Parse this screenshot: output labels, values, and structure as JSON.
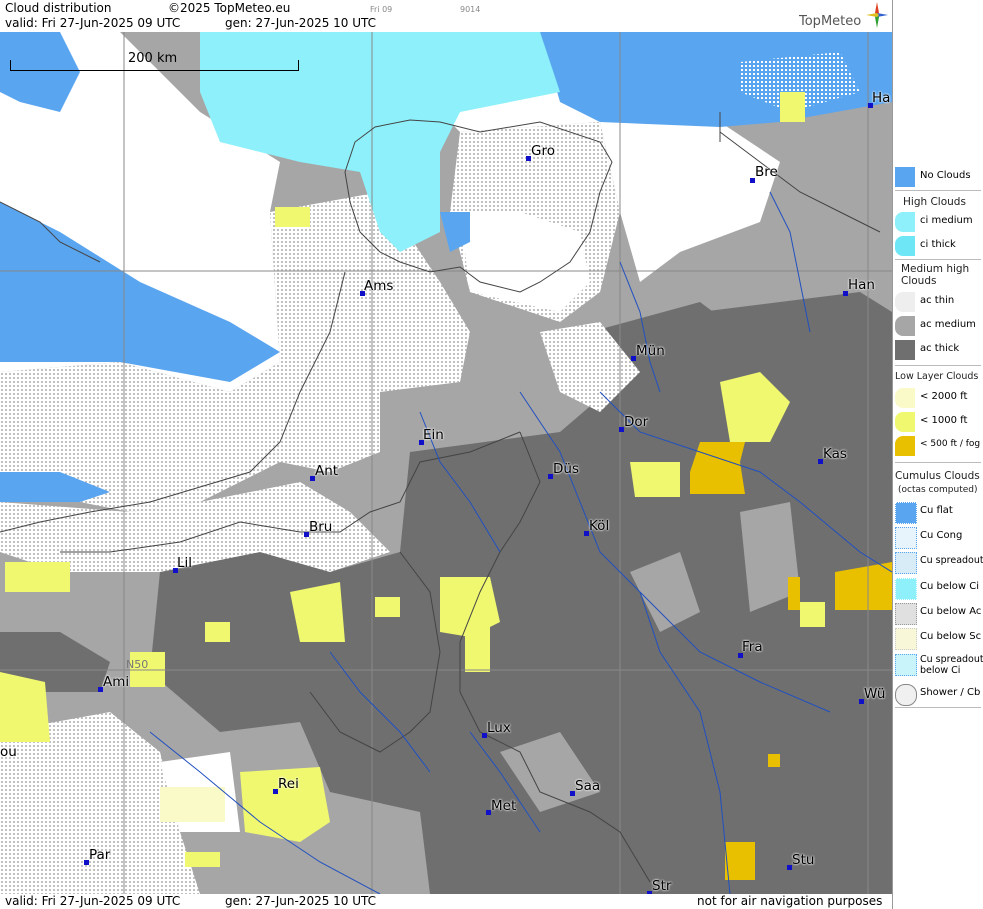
{
  "header": {
    "title": "Cloud distribution",
    "copyright": "©2025 TopMeteo.eu",
    "valid": "valid:  Fri  27-Jun-2025  09 UTC",
    "gen": "gen: 27-Jun-2025 10 UTC",
    "slot": "Fri 09",
    "code": "9014",
    "logo": "TopMeteo"
  },
  "scale": {
    "label": "200 km"
  },
  "grid_label": "N50",
  "cities": [
    {
      "name": "Gro"
    },
    {
      "name": "Bre"
    },
    {
      "name": "Ha"
    },
    {
      "name": "Ams"
    },
    {
      "name": "Han"
    },
    {
      "name": "Mün"
    },
    {
      "name": "Ein"
    },
    {
      "name": "Dor"
    },
    {
      "name": "Kas"
    },
    {
      "name": "Ant"
    },
    {
      "name": "Düs"
    },
    {
      "name": "Bru"
    },
    {
      "name": "Köl"
    },
    {
      "name": "Lil"
    },
    {
      "name": "Fra"
    },
    {
      "name": "Ami"
    },
    {
      "name": "Wü"
    },
    {
      "name": "ou"
    },
    {
      "name": "Lux"
    },
    {
      "name": "Rei"
    },
    {
      "name": "Saa"
    },
    {
      "name": "Met"
    },
    {
      "name": "Par"
    },
    {
      "name": "Stu"
    },
    {
      "name": "Str"
    }
  ],
  "legend": {
    "no_clouds": "No Clouds",
    "high_head": "High Clouds",
    "ci_medium": "ci medium",
    "ci_thick": "ci thick",
    "medium_head": "Medium high Clouds",
    "ac_thin": "ac thin",
    "ac_medium": "ac medium",
    "ac_thick": "ac thick",
    "low_head": "Low Layer Clouds",
    "low_2000": "< 2000 ft",
    "low_1000": "< 1000 ft",
    "low_500": "< 500 ft / fog",
    "cu_head": "Cumulus Clouds",
    "cu_sub": "(octas computed)",
    "cu_flat": "Cu flat",
    "cu_cong": "Cu Cong",
    "cu_spread": "Cu spreadout",
    "cu_below_ci": "Cu below Ci",
    "cu_below_ac": "Cu below Ac",
    "cu_below_sc": "Cu below Sc",
    "cu_spread_ci": "Cu spreadout below Ci",
    "shower": "Shower / Cb"
  },
  "footer": {
    "valid": "valid:  Fri  27-Jun-2025  09 UTC",
    "gen": "gen: 27-Jun-2025 10 UTC",
    "note": "not for air navigation purposes"
  },
  "colors": {
    "no_clouds": "#5aa5ef",
    "ci_medium": "#8df0fa",
    "ac_medium": "#a6a6a6",
    "ac_thick": "#6f6f6f",
    "low_2000": "#fafac8",
    "low_1000": "#f0f870",
    "low_500": "#e8c000",
    "river": "#2050c0",
    "border": "#444444"
  }
}
